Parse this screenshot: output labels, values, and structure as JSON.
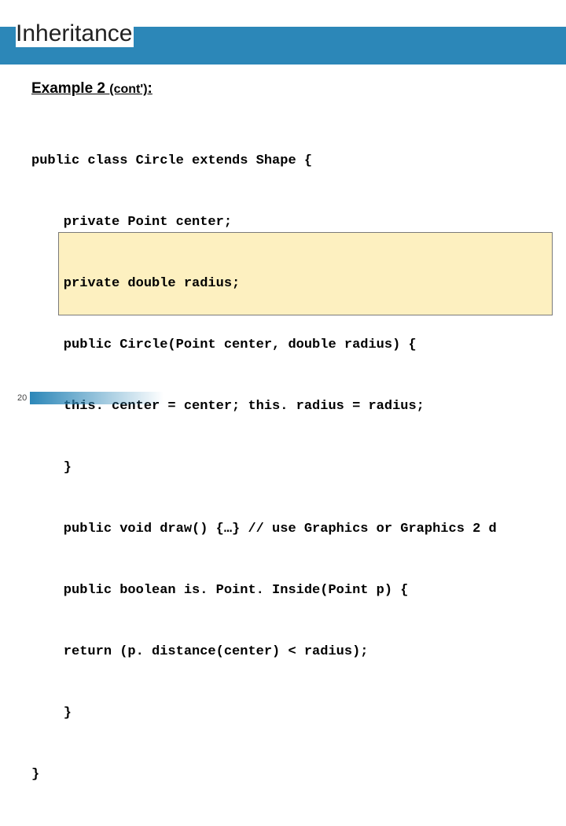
{
  "title": "Inheritance",
  "subtitle_main": "Example 2 ",
  "subtitle_paren": "(cont')",
  "subtitle_colon": ":",
  "code": {
    "l1": "public class Circle extends Shape {",
    "l2": "    private Point center;",
    "l3": "    private double radius;",
    "l4": "    public Circle(Point center, double radius) {",
    "l5": "    this. center = center; this. radius = radius;",
    "l6": "    }",
    "l7": "    public void draw() {…} // use Graphics or Graphics 2 d",
    "l8": "    public boolean is. Point. Inside(Point p) {",
    "l9": "    return (p. distance(center) < radius);",
    "l10": "    }",
    "l11": "}"
  },
  "page_number": "20"
}
